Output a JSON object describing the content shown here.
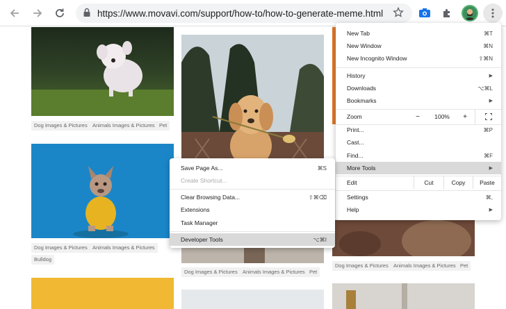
{
  "browser": {
    "url": "https://www.movavi.com/support/how-to/how-to-generate-meme.html"
  },
  "page": {
    "tags": [
      {
        "text": "Dog Images & Pictures"
      },
      {
        "text": "Animals Images & Pictures"
      },
      {
        "text": "Pet"
      },
      {
        "text": "Dog Images & Pictures"
      },
      {
        "text": "Animals Images & Pictures"
      },
      {
        "text": "Bulldog"
      },
      {
        "text": "Dog Images & Pictures"
      },
      {
        "text": "Animals Images & Pictures"
      },
      {
        "text": "Pet"
      },
      {
        "text": "Dog Images & Pictures"
      },
      {
        "text": "Animals Images & Pictures"
      },
      {
        "text": "Pet"
      }
    ]
  },
  "menu": {
    "new_tab": {
      "label": "New Tab",
      "shortcut": "⌘T"
    },
    "new_window": {
      "label": "New Window",
      "shortcut": "⌘N"
    },
    "new_incognito": {
      "label": "New Incognito Window",
      "shortcut": "⇧⌘N"
    },
    "history": {
      "label": "History"
    },
    "downloads": {
      "label": "Downloads",
      "shortcut": "⌥⌘L"
    },
    "bookmarks": {
      "label": "Bookmarks"
    },
    "zoom": {
      "label": "Zoom",
      "minus": "−",
      "value": "100%",
      "plus": "+"
    },
    "print": {
      "label": "Print...",
      "shortcut": "⌘P"
    },
    "cast": {
      "label": "Cast..."
    },
    "find": {
      "label": "Find...",
      "shortcut": "⌘F"
    },
    "more_tools": {
      "label": "More Tools"
    },
    "edit": {
      "label": "Edit",
      "cut": "Cut",
      "copy": "Copy",
      "paste": "Paste"
    },
    "settings": {
      "label": "Settings",
      "shortcut": "⌘,"
    },
    "help": {
      "label": "Help"
    }
  },
  "submenu": {
    "save_page": {
      "label": "Save Page As...",
      "shortcut": "⌘S"
    },
    "create_shortcut": {
      "label": "Create Shortcut..."
    },
    "clear_data": {
      "label": "Clear Browsing Data...",
      "shortcut": "⇧⌘⌫"
    },
    "extensions": {
      "label": "Extensions"
    },
    "task_manager": {
      "label": "Task Manager"
    },
    "developer_tools": {
      "label": "Developer Tools",
      "shortcut": "⌥⌘I"
    }
  },
  "colors": {
    "accent": "#1a73e8",
    "menu_highlight": "#d9d9d9"
  }
}
